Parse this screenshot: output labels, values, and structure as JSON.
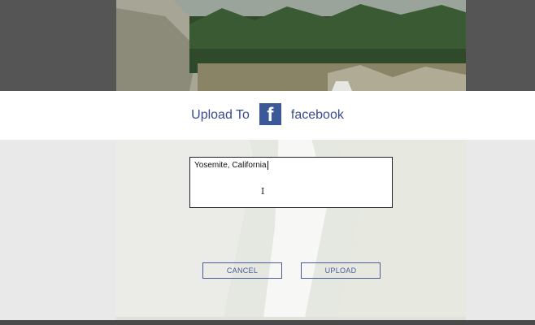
{
  "dialog": {
    "title_prefix": "Upload To",
    "service_logo_letter": "f",
    "service_name": "facebook"
  },
  "caption": {
    "value": "Yosemite, California"
  },
  "buttons": {
    "cancel_label": "CANCEL",
    "upload_label": "UPLOAD"
  },
  "colors": {
    "accent": "#3b4a8c",
    "facebook_blue": "#3b5998"
  }
}
